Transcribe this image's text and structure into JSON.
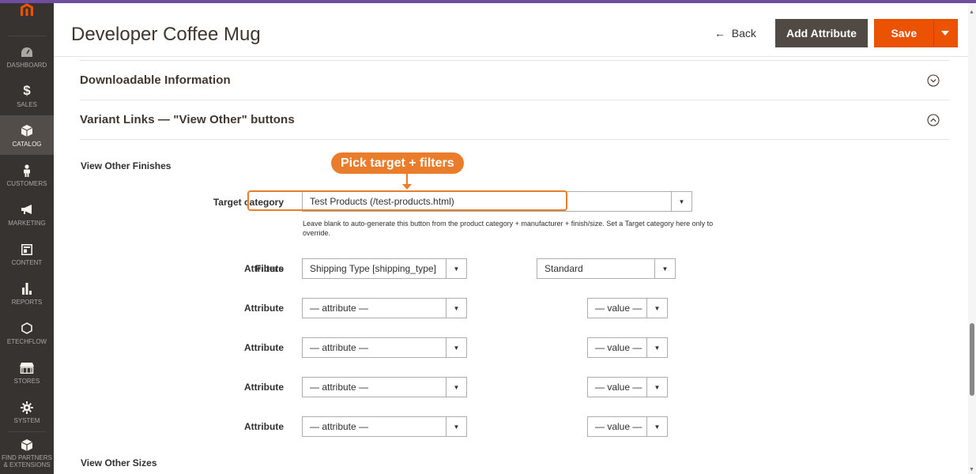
{
  "sidebar": {
    "items": [
      {
        "label": "DASHBOARD",
        "icon": "dashboard-icon"
      },
      {
        "label": "SALES",
        "icon": "dollar-icon"
      },
      {
        "label": "CATALOG",
        "icon": "catalog-icon"
      },
      {
        "label": "CUSTOMERS",
        "icon": "customers-icon"
      },
      {
        "label": "MARKETING",
        "icon": "megaphone-icon"
      },
      {
        "label": "CONTENT",
        "icon": "content-icon"
      },
      {
        "label": "REPORTS",
        "icon": "reports-icon"
      },
      {
        "label": "ETECHFLOW",
        "icon": "hexagon-icon"
      },
      {
        "label": "STORES",
        "icon": "store-icon"
      },
      {
        "label": "SYSTEM",
        "icon": "gear-icon"
      },
      {
        "label": "FIND PARTNERS & EXTENSIONS",
        "icon": "extensions-icon"
      }
    ],
    "active": "CATALOG"
  },
  "header": {
    "title": "Developer Coffee Mug",
    "back_label": "Back",
    "back_arrow": "←",
    "add_attribute_label": "Add Attribute",
    "save_label": "Save"
  },
  "sections": {
    "downloadable": "Downloadable Information",
    "variant_links": "Variant Links — \"View Other\" buttons"
  },
  "finishes": {
    "title": "View Other Finishes",
    "target_category_label": "Target category",
    "target_category_value": "Test Products (/test-products.html)",
    "note": "Leave blank to auto-generate this button from the product category + manufacturer + finish/size. Set a Target category here only to override.",
    "filter_rows": [
      {
        "label": "Attribute",
        "overlay_label": "Filters",
        "attribute": "Shipping Type [shipping_type]",
        "value": "Standard"
      },
      {
        "label": "Attribute",
        "attribute": "— attribute —",
        "value": "— value —"
      },
      {
        "label": "Attribute",
        "attribute": "— attribute —",
        "value": "— value —"
      },
      {
        "label": "Attribute",
        "attribute": "— attribute —",
        "value": "— value —"
      },
      {
        "label": "Attribute",
        "attribute": "— attribute —",
        "value": "— value —"
      }
    ]
  },
  "sizes": {
    "title": "View Other Sizes"
  },
  "annotation": {
    "callout": "Pick target + filters"
  },
  "colors": {
    "brand_orange": "#eb5202",
    "sidebar_bg": "#373330",
    "annotation": "#ea7d2b",
    "top_accent": "#6f4ea1"
  }
}
